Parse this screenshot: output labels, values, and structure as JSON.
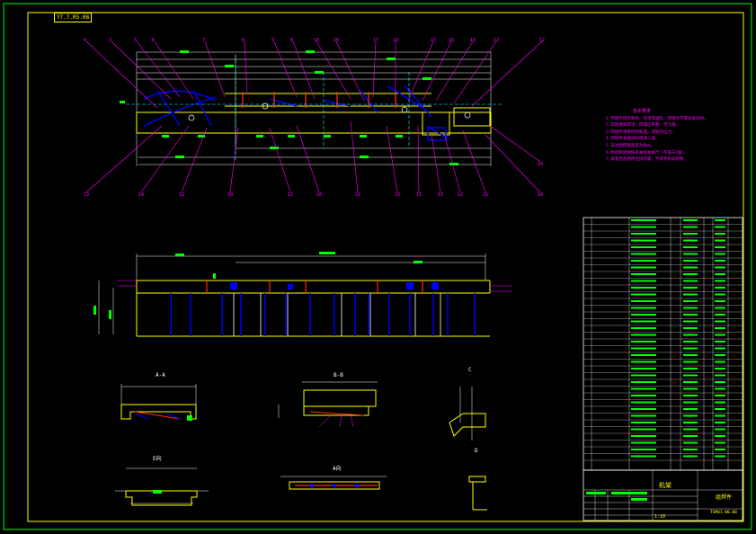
{
  "drawing": {
    "stamp_text": "Y7.7.R5.08",
    "notes_title": "技术要求",
    "notes": [
      "1.焊缝不得有裂纹、夹渣等缺陷，焊接时不得烧穿母材。",
      "2.焊后清除焊渣，焊缝应平整、无飞溅。",
      "3.焊接件须经时效处理，消除内应力。",
      "4.焊接件表面涂防锈漆二道。",
      "5.未注明焊缝高度为8mm。",
      "6.制造和验收按有关标准执行（不低于C级）。",
      "7.安装后各部件连接可靠，不得有松动现象。"
    ],
    "section_labels": [
      "A-A",
      "B-B",
      "C",
      "D",
      "E向",
      "A向"
    ],
    "title_block": {
      "title": "机架",
      "drawing_no": "TSM01.00.00",
      "material": "组焊件",
      "scale": "1:10"
    }
  }
}
